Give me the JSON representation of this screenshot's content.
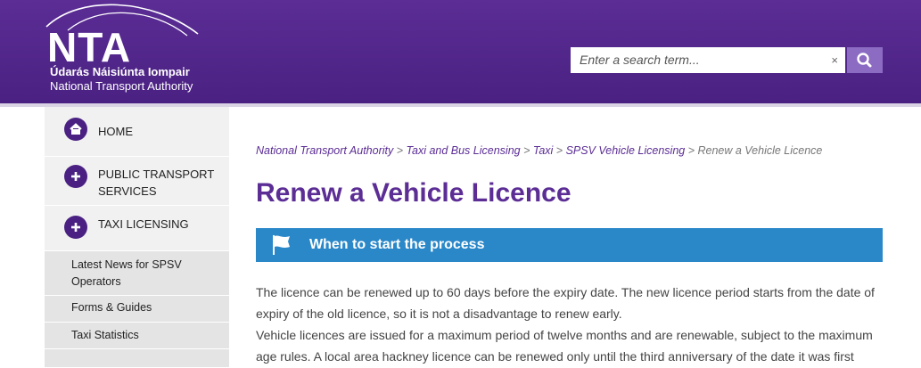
{
  "header": {
    "logo_text": "NTA",
    "org_irish": "Údarás Náisiúnta Iompair",
    "org_english": "National Transport Authority"
  },
  "search": {
    "placeholder": "Enter a search term...",
    "clear_glyph": "×",
    "button_icon": "magnifier-icon"
  },
  "sidebar": {
    "items": [
      {
        "label": "HOME",
        "icon": "home-icon"
      },
      {
        "label": "PUBLIC TRANSPORT SERVICES",
        "icon": "plus-icon"
      },
      {
        "label": "TAXI LICENSING",
        "icon": "plus-icon"
      }
    ],
    "sub_items": [
      {
        "label": "Latest News for SPSV Operators"
      },
      {
        "label": "Forms & Guides"
      },
      {
        "label": "Taxi Statistics"
      }
    ]
  },
  "breadcrumb": {
    "links": [
      "National Transport Authority",
      "Taxi and Bus Licensing",
      "Taxi",
      "SPSV Vehicle Licensing"
    ],
    "separator": " > ",
    "current": "Renew a Vehicle Licence"
  },
  "page_title": "Renew a Vehicle Licence",
  "section": {
    "title": "When to start the process",
    "icon": "flag-icon"
  },
  "body": {
    "paragraph_1": "The licence can be renewed up to 60 days before the expiry date. The new licence period starts from the date of expiry of the old licence, so it is not a disadvantage to renew early.",
    "paragraph_2": "Vehicle licences are issued for a maximum period of twelve months and are renewable, subject to the maximum age rules. A local area hackney licence can be renewed only until the third anniversary of the date it was first"
  },
  "colors": {
    "brand_purple": "#4a2182",
    "accent_blue": "#2a88c9",
    "search_button": "#8c6bc2"
  }
}
